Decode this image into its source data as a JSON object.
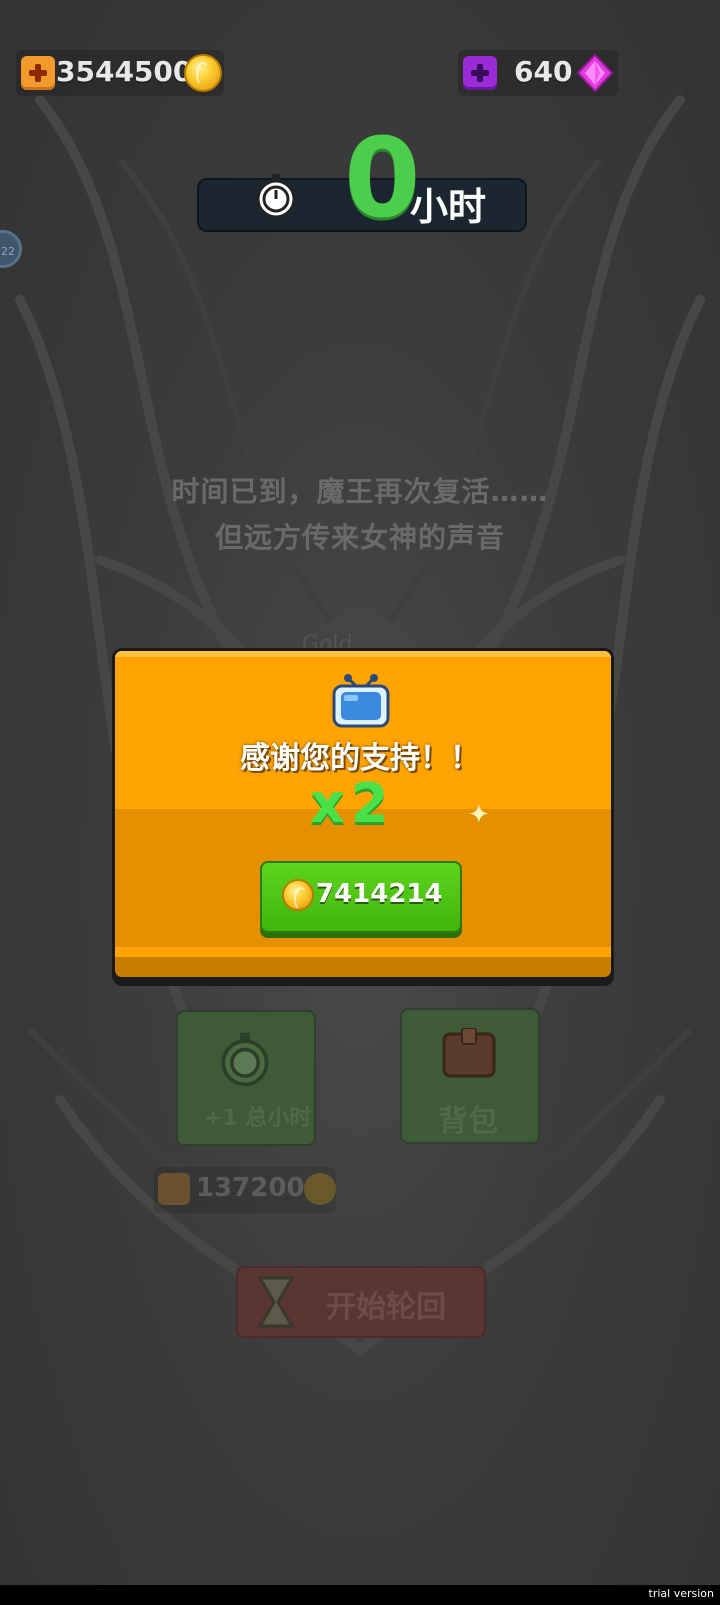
{
  "top": {
    "gold": "3544500",
    "gems": "640"
  },
  "timer": {
    "value": "0",
    "unit": "小时"
  },
  "side_bubble": "22",
  "story": {
    "line1": "时间已到，魔王再次复活……",
    "line2": "但远方传来女神的声音"
  },
  "faint_label": "Gold",
  "dialog": {
    "thanks": "感谢您的支持！！",
    "multiplier": "x2",
    "reward": "7414214"
  },
  "background_ui": {
    "hours_button": "+1 总小时",
    "backpack_button": "背包",
    "bonus_gold": "137200",
    "start_button": "开始轮回"
  },
  "footer": "trial version",
  "colors": {
    "dialog": "#ffa402",
    "accent_green": "#49e04a",
    "gem": "#e040e0",
    "coin": "#ffd23a"
  },
  "icons": [
    "add-gold-icon",
    "gold-coin-icon",
    "add-gem-icon",
    "gem-icon",
    "stopwatch-icon",
    "tv-icon",
    "sparkle-icon",
    "hourglass-icon",
    "backpack-icon"
  ]
}
